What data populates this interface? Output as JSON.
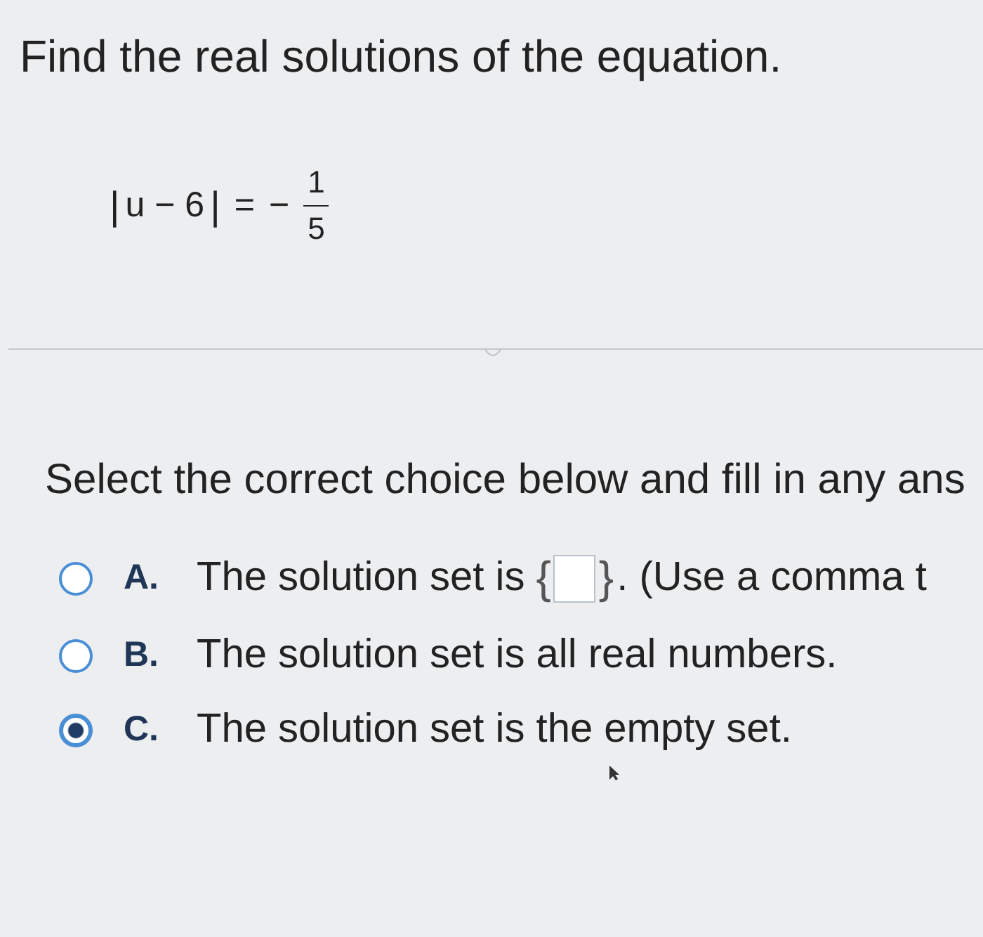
{
  "question": {
    "title": "Find the real solutions of the equation.",
    "equation": {
      "left_bar": "|",
      "expression": "u − 6",
      "right_bar": "|",
      "equals": "=",
      "sign": "−",
      "numerator": "1",
      "denominator": "5"
    }
  },
  "instruction": "Select the correct choice below and fill in any ans",
  "options": [
    {
      "letter": "A.",
      "kind": "fill",
      "text_before": "The solution set is",
      "brace_open": "{",
      "brace_close": "}",
      "text_after": ". (Use a comma t",
      "selected": false
    },
    {
      "letter": "B.",
      "kind": "plain",
      "text": "The solution set is all real numbers.",
      "selected": false
    },
    {
      "letter": "C.",
      "kind": "plain",
      "text": "The solution set is the empty set.",
      "selected": true
    }
  ]
}
